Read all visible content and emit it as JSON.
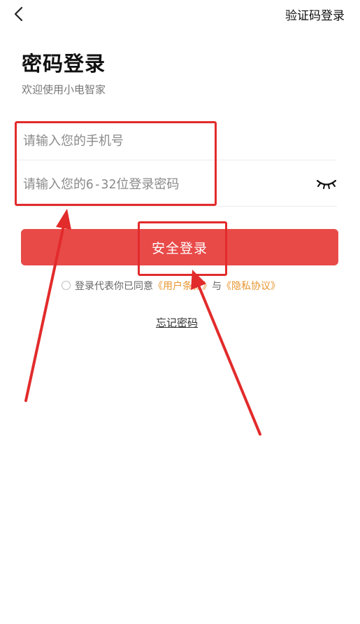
{
  "header": {
    "switch_label": "验证码登录"
  },
  "title": "密码登录",
  "subtitle": "欢迎使用小电智家",
  "form": {
    "phone_placeholder": "请输入您的手机号",
    "password_placeholder": "请输入您的6-32位登录密码",
    "submit_label": "安全登录"
  },
  "agreement": {
    "prefix": "登录代表你已同意",
    "terms": "《用户条款》",
    "conjunction": "与",
    "privacy": "《隐私协议》"
  },
  "forgot_label": "忘记密码",
  "colors": {
    "accent": "#e84a48",
    "link": "#e8952f",
    "annotation": "#e22b2b"
  },
  "icons": [
    "back-arrow-icon",
    "eye-closed-icon"
  ]
}
